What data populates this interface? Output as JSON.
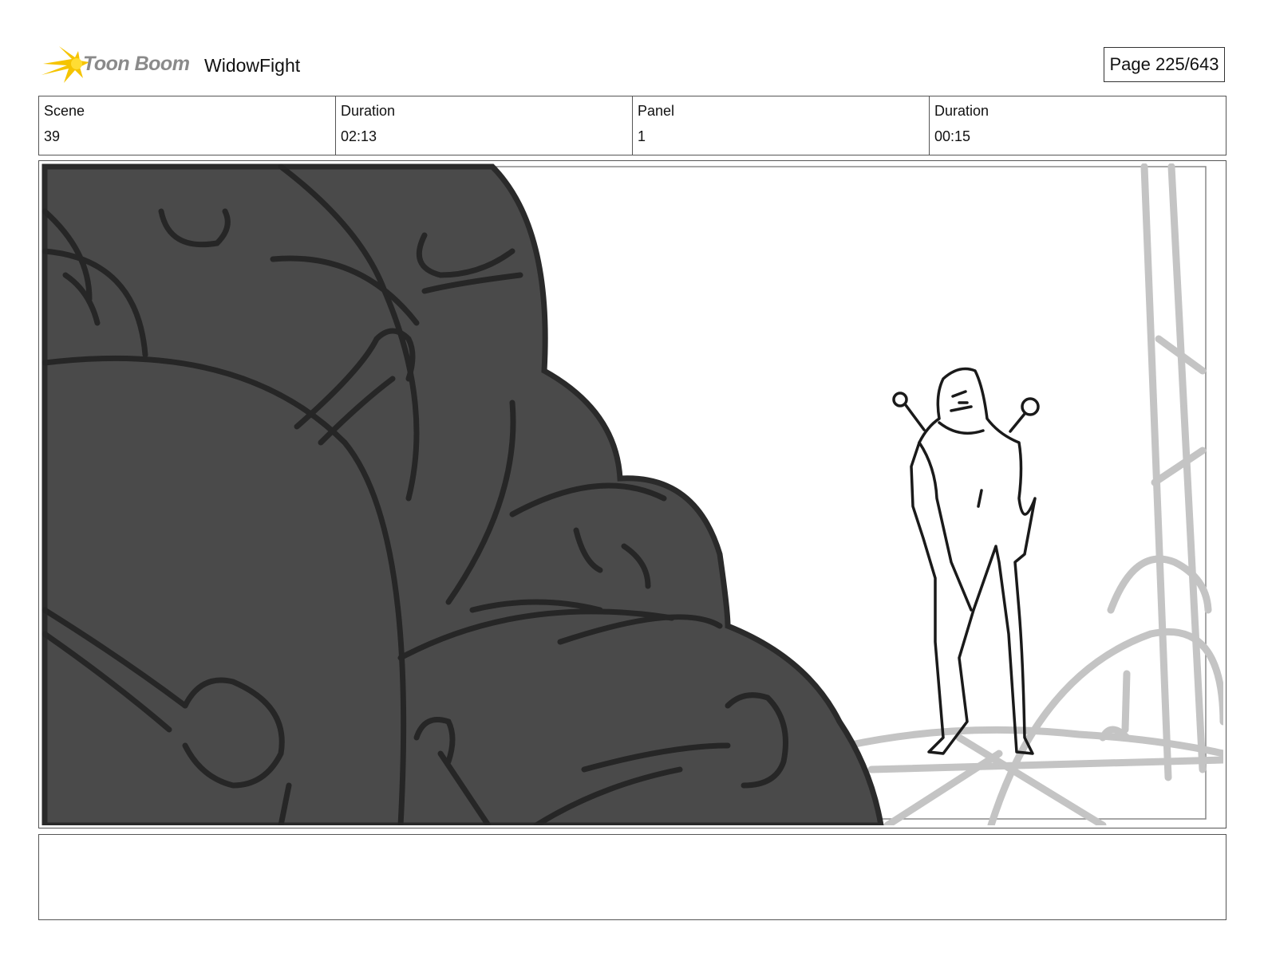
{
  "header": {
    "brand": "Toon Boom",
    "project_title": "WidowFight",
    "page_label": "Page 225/643"
  },
  "info": [
    {
      "label": "Scene",
      "value": "39"
    },
    {
      "label": "Duration",
      "value": "02:13"
    },
    {
      "label": "Panel",
      "value": "1"
    },
    {
      "label": "Duration",
      "value": "00:15"
    }
  ],
  "panel": {
    "caption": "",
    "colors": {
      "smoke": "#4a4a4a",
      "line": "#1a1a1a",
      "background_sketch": "#c4c4c4",
      "logo": "#f5c400"
    }
  }
}
